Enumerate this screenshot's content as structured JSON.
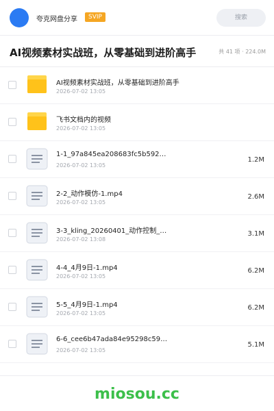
{
  "topbar": {
    "brand": "夸克网盘分享",
    "badge": "SVIP",
    "search_placeholder": "搜索",
    "avatar_color": "#2b7bf3",
    "badge_color": "#f5a623"
  },
  "header": {
    "title": "AI视频素材实战班，从零基础到进阶高手",
    "summary": "共 41 项 · 224.0M"
  },
  "files": [
    {
      "name": "AI视频素材实战班，从零基础到进阶高手",
      "date": "2026-07-02 13:05",
      "size": "",
      "icon": "folder-icon"
    },
    {
      "name": "飞书文档内的视频",
      "date": "2026-07-02 13:05",
      "size": "",
      "icon": "folder-icon"
    },
    {
      "name": "1-1_97a845ea208683fc5b592…",
      "date": "2026-07-02 13:05",
      "size": "1.2M",
      "icon": "file-icon"
    },
    {
      "name": "2-2_动作模仿-1.mp4",
      "date": "2026-07-02 13:05",
      "size": "2.6M",
      "icon": "file-icon"
    },
    {
      "name": "3-3_kling_20260401_动作控制__…",
      "date": "2026-07-02 13:08",
      "size": "3.1M",
      "icon": "file-icon"
    },
    {
      "name": "4-4_4月9日-1.mp4",
      "date": "2026-07-02 13:05",
      "size": "6.2M",
      "icon": "file-icon"
    },
    {
      "name": "5-5_4月9日-1.mp4",
      "date": "2026-07-02 13:05",
      "size": "6.2M",
      "icon": "file-icon"
    },
    {
      "name": "6-6_cee6b47ada84e95298c59…",
      "date": "2026-07-02 13:05",
      "size": "5.1M",
      "icon": "file-icon"
    }
  ],
  "footer": {
    "watermark": "miosou.cc",
    "watermark_color": "#3cbf4a"
  }
}
